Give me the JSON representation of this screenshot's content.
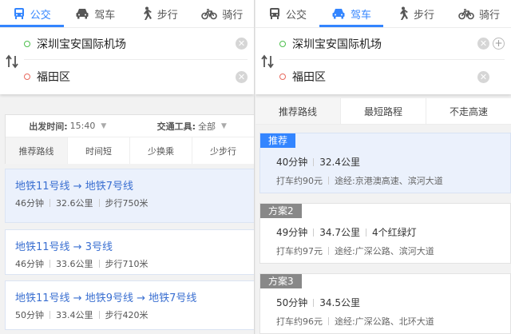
{
  "colors": {
    "accent": "#3385ff",
    "selected_bg": "#ebf1fc",
    "start_dot": "#4cbf4c",
    "end_dot": "#e86a5f"
  },
  "left": {
    "modes": [
      {
        "label": "公交",
        "icon": "bus-icon",
        "active": true
      },
      {
        "label": "驾车",
        "icon": "car-icon",
        "active": false
      },
      {
        "label": "步行",
        "icon": "walk-icon",
        "active": false
      },
      {
        "label": "骑行",
        "icon": "bike-icon",
        "active": false
      }
    ],
    "start": "深圳宝安国际机场",
    "end": "福田区",
    "options": {
      "depart_label": "出发时间:",
      "depart_value": "15:40",
      "tool_label": "交通工具:",
      "tool_value": "全部",
      "sorts": [
        "推荐路线",
        "时间短",
        "少换乘",
        "少步行"
      ]
    },
    "routes": [
      {
        "title": "地铁11号线 → 地铁7号线",
        "time": "46分钟",
        "distance": "32.6公里",
        "walk": "步行750米"
      },
      {
        "title": "地铁11号线 → 3号线",
        "time": "46分钟",
        "distance": "33.6公里",
        "walk": "步行710米"
      },
      {
        "title": "地铁11号线 → 地铁9号线 → 地铁7号线",
        "time": "50分钟",
        "distance": "33.4公里",
        "walk": "步行420米"
      }
    ]
  },
  "right": {
    "modes": [
      {
        "label": "公交",
        "icon": "bus-icon",
        "active": false
      },
      {
        "label": "驾车",
        "icon": "car-icon",
        "active": true
      },
      {
        "label": "步行",
        "icon": "walk-icon",
        "active": false
      },
      {
        "label": "骑行",
        "icon": "bike-icon",
        "active": false
      }
    ],
    "start": "深圳宝安国际机场",
    "end": "福田区",
    "tabs": [
      "推荐路线",
      "最短路程",
      "不走高速"
    ],
    "plans": [
      {
        "badge": "推荐",
        "time": "40分钟",
        "distance": "32.4公里",
        "lights": "",
        "taxi": "打车约90元",
        "via_label": "途经:",
        "via": "京港澳高速、滨河大道"
      },
      {
        "badge": "方案2",
        "time": "49分钟",
        "distance": "34.7公里",
        "lights": "4个红绿灯",
        "taxi": "打车约97元",
        "via_label": "途经:",
        "via": "广深公路、滨河大道"
      },
      {
        "badge": "方案3",
        "time": "50分钟",
        "distance": "34.5公里",
        "lights": "",
        "taxi": "打车约96元",
        "via_label": "途经:",
        "via": "广深公路、北环大道"
      }
    ]
  }
}
